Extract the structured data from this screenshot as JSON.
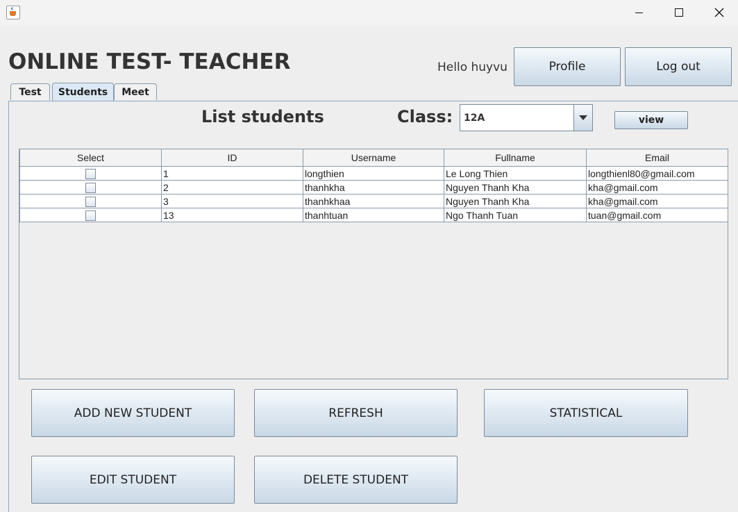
{
  "window": {
    "controls": {
      "minimize": "minimize-icon",
      "maximize": "maximize-icon",
      "close": "close-icon"
    }
  },
  "header": {
    "title": "ONLINE TEST- TEACHER",
    "greeting": "Hello huyvu",
    "profile_label": "Profile",
    "logout_label": "Log out"
  },
  "tabs": [
    {
      "label": "Test"
    },
    {
      "label": "Students",
      "selected": true
    },
    {
      "label": "Meet"
    }
  ],
  "students": {
    "title": "List students",
    "class_label": "Class:",
    "class_value": "12A",
    "view_label": "view",
    "table": {
      "columns": [
        "Select",
        "ID",
        "Username",
        "Fullname",
        "Email"
      ],
      "rows": [
        {
          "id": "1",
          "username": "longthien",
          "fullname": "Le Long Thien",
          "email": "longthienl80@gmail.com"
        },
        {
          "id": "2",
          "username": "thanhkha",
          "fullname": "Nguyen Thanh Kha",
          "email": "kha@gmail.com"
        },
        {
          "id": "3",
          "username": "thanhkhaa",
          "fullname": "Nguyen Thanh Kha",
          "email": "kha@gmail.com"
        },
        {
          "id": "13",
          "username": "thanhtuan",
          "fullname": "Ngo Thanh Tuan",
          "email": "tuan@gmail.com"
        }
      ]
    }
  },
  "actions": {
    "add": "ADD NEW STUDENT",
    "refresh": "REFRESH",
    "statistical": "STATISTICAL",
    "edit": "EDIT STUDENT",
    "delete": "DELETE STUDENT"
  }
}
